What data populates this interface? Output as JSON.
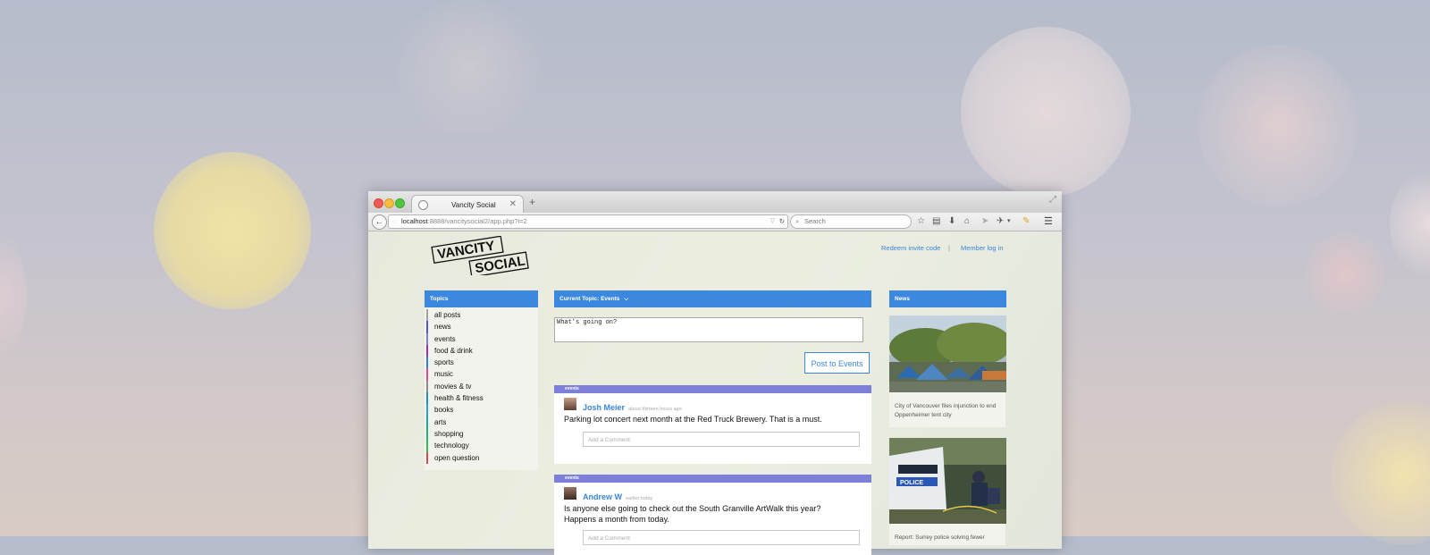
{
  "browser": {
    "tab_title": "Vancity Social",
    "url_host": "localhost",
    "url_path": ":8888/vancitysocial2/app.php?i=2",
    "search_placeholder": "Search"
  },
  "site": {
    "logo_line1": "VANCITY",
    "logo_line2": "SOCIAL",
    "redeem_link": "Redeem invite code",
    "separator": "|",
    "login_link": "Member log in"
  },
  "topics": {
    "header": "Topics",
    "items": [
      {
        "label": "all posts",
        "color": "#a0a0a0"
      },
      {
        "label": "news",
        "color": "#4b58c8"
      },
      {
        "label": "events",
        "color": "#7b7fd9"
      },
      {
        "label": "food & drink",
        "color": "#9b2fb2"
      },
      {
        "label": "sports",
        "color": "#2f7fd8"
      },
      {
        "label": "music",
        "color": "#d74d8e"
      },
      {
        "label": "movies & tv",
        "color": "#8b8b8b"
      },
      {
        "label": "health & fitness",
        "color": "#1f8fbf"
      },
      {
        "label": "books",
        "color": "#2f9ed8"
      },
      {
        "label": "arts",
        "color": "#1fa89a"
      },
      {
        "label": "shopping",
        "color": "#20b07a"
      },
      {
        "label": "technology",
        "color": "#2fbb5e"
      },
      {
        "label": "open question",
        "color": "#d84b4b"
      }
    ]
  },
  "feed": {
    "header": "Current Topic: Events",
    "input_placeholder": "What's going on?",
    "post_button": "Post to Events",
    "posts": [
      {
        "tag": "events",
        "author": "Josh Meier",
        "time": "about thirteen hours ago",
        "message": "Parking lot concert next month at the Red Truck Brewery. That is a must.",
        "comment_placeholder": "Add a Comment"
      },
      {
        "tag": "events",
        "author": "Andrew W",
        "time": "earlier today",
        "message": "Is anyone else going to check out the South Granville ArtWalk this year? Happens a month from today.",
        "comment_placeholder": "Add a Comment"
      }
    ]
  },
  "news": {
    "header": "News",
    "items": [
      {
        "caption": "City of Vancouver files injunction to end Oppenheimer tent city"
      },
      {
        "caption": "Report: Surrey police solving fewer"
      }
    ]
  },
  "colors": {
    "accent": "#3c88e0",
    "tag": "#7d7fd9"
  }
}
